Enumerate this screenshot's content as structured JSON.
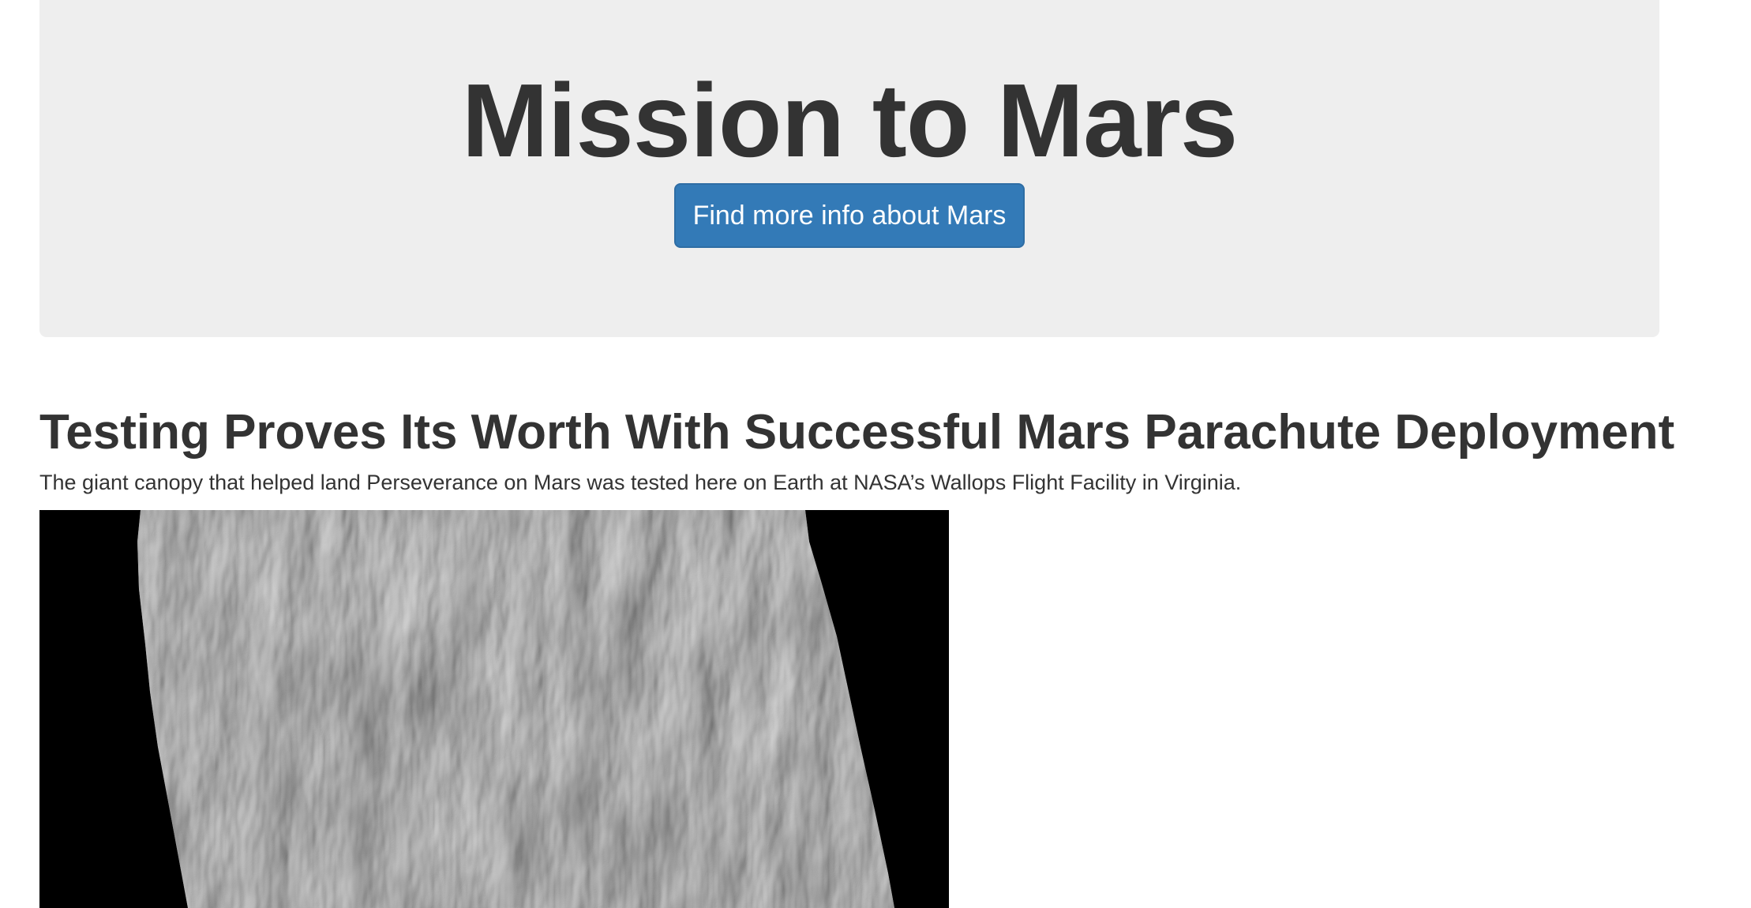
{
  "jumbotron": {
    "title": "Mission to Mars",
    "button_label": "Find more info about Mars",
    "background_color": "#eeeeee",
    "button_color": "#337ab7"
  },
  "news": {
    "title": "Testing Proves Its Worth With Successful Mars Parachute Deployment",
    "teaser": "The giant canopy that helped land Perseverance on Mars was tested here on Earth at NASA’s Wallops Flight Facility in Virginia."
  },
  "featured_image": {
    "subject": "grayscale-mars-dune-field-image"
  }
}
